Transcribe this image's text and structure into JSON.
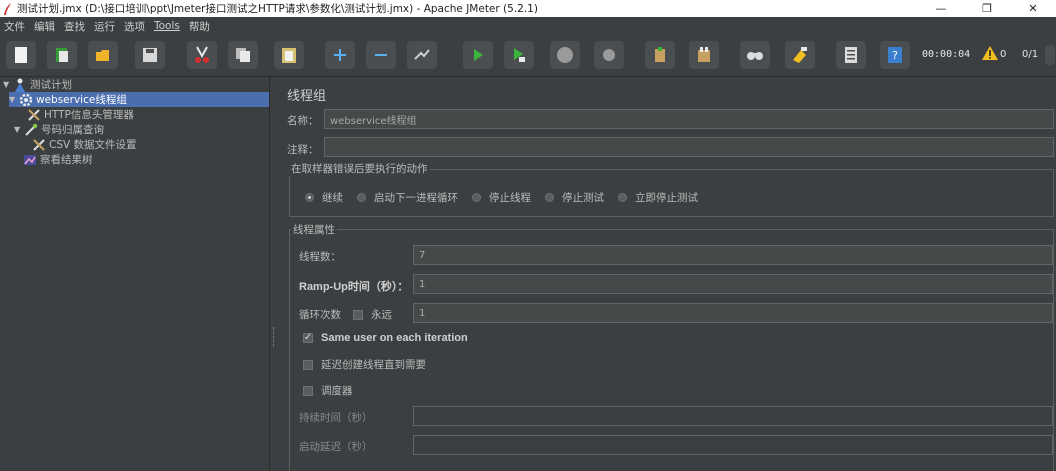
{
  "window": {
    "title": "测试计划.jmx (D:\\接口培训\\ppt\\Jmeter接口测试之HTTP请求\\参数化\\测试计划.jmx) - Apache JMeter (5.2.1)",
    "controls": [
      "—",
      "❐",
      "✕"
    ]
  },
  "menu": [
    "文件",
    "编辑",
    "查找",
    "运行",
    "选项",
    "Tools",
    "帮助"
  ],
  "toolbar": {
    "timer": "00:00:04",
    "warn_count": "0",
    "threads": "0/1",
    "buttons": [
      {
        "name": "new-icon",
        "color": "#f2f2f2"
      },
      {
        "name": "templates-icon",
        "color": "#3a9b3a"
      },
      {
        "name": "open-icon",
        "color": "#f0b429"
      },
      {
        "name": "save-icon",
        "color": "#d8d8d8"
      },
      {
        "name": "cut-icon",
        "color": "#d23030"
      },
      {
        "name": "copy-icon",
        "color": "#d8d8d8"
      },
      {
        "name": "paste-icon",
        "color": "#d8c070"
      },
      {
        "name": "expand-icon",
        "color": "#5ab0f0"
      },
      {
        "name": "collapse-icon",
        "color": "#5ab0f0"
      },
      {
        "name": "toggle-icon",
        "color": "#cfcfcf"
      },
      {
        "name": "start-icon",
        "color": "#3cb43c"
      },
      {
        "name": "start-no-pause-icon",
        "color": "#3cb43c"
      },
      {
        "name": "stop-icon",
        "color": "#9a9a9a"
      },
      {
        "name": "shutdown-icon",
        "color": "#9a9a9a"
      },
      {
        "name": "clear-icon",
        "color": "#c8a060"
      },
      {
        "name": "clear-all-icon",
        "color": "#c8a060"
      },
      {
        "name": "search-icon",
        "color": "#dcdcdc"
      },
      {
        "name": "reset-search-icon",
        "color": "#f0c020"
      },
      {
        "name": "function-helper-icon",
        "color": "#dcdcdc"
      },
      {
        "name": "help-icon",
        "color": "#3a7fd0"
      }
    ]
  },
  "tree": {
    "items": [
      {
        "label": "测试计划",
        "icon": "test-plan-icon",
        "expander": "▼",
        "indent": 0,
        "selected": false
      },
      {
        "label": "webservice线程组",
        "icon": "thread-group-icon",
        "expander": "▼",
        "indent": 1,
        "selected": true
      },
      {
        "label": "HTTP信息头管理器",
        "icon": "tool-icon",
        "expander": "",
        "indent": 2,
        "selected": false
      },
      {
        "label": "号码归属查询",
        "icon": "sampler-icon",
        "expander": "▼",
        "indent": 1,
        "selected": false
      },
      {
        "label": "CSV 数据文件设置",
        "icon": "tool-icon",
        "expander": "",
        "indent": 2,
        "selected": false
      },
      {
        "label": "察看结果树",
        "icon": "listener-icon",
        "expander": "",
        "indent": 1,
        "selected": false
      }
    ]
  },
  "panel": {
    "title": "线程组",
    "name_label": "名称：",
    "name_value": "webservice线程组",
    "comment_label": "注释：",
    "comment_value": "",
    "error_group": {
      "title": "在取样器错误后要执行的动作",
      "options": [
        {
          "label": "继续",
          "checked": true
        },
        {
          "label": "启动下一进程循环",
          "checked": false
        },
        {
          "label": "停止线程",
          "checked": false
        },
        {
          "label": "停止测试",
          "checked": false
        },
        {
          "label": "立即停止测试",
          "checked": false
        }
      ]
    },
    "thread_props": {
      "title": "线程属性",
      "threads_label": "线程数：",
      "threads_value": "7",
      "rampup_label": "Ramp-Up时间（秒）：",
      "rampup_value": "1",
      "loop_label": "循环次数",
      "forever_label": "永远",
      "forever_checked": false,
      "loop_value": "1",
      "same_user_label": "Same user on each iteration",
      "same_user_checked": true,
      "delay_label": "延迟创建线程直到需要",
      "delay_checked": false,
      "scheduler_label": "调度器",
      "scheduler_checked": false,
      "duration_label": "持续时间（秒）",
      "duration_value": "",
      "startup_delay_label": "启动延迟（秒）",
      "startup_delay_value": ""
    }
  }
}
